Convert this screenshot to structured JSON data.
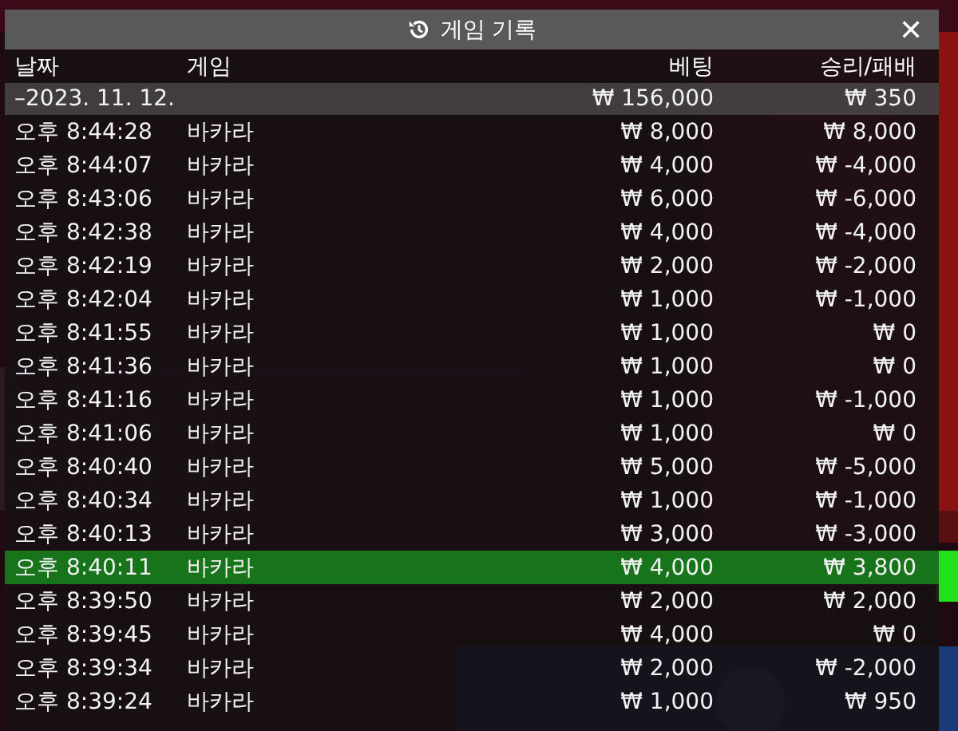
{
  "dialog": {
    "title": "게임 기록",
    "close": "✕"
  },
  "table": {
    "columns": [
      "날짜",
      "게임",
      "베팅",
      "승리/패배"
    ],
    "summary": {
      "date": "–2023. 11. 12.",
      "bet": "₩ 156,000",
      "result": "₩ 350"
    },
    "rows": [
      {
        "time": "오후 8:44:28",
        "game": "바카라",
        "bet": "₩ 8,000",
        "result": "₩ 8,000",
        "selected": false
      },
      {
        "time": "오후 8:44:07",
        "game": "바카라",
        "bet": "₩ 4,000",
        "result": "₩ -4,000",
        "selected": false
      },
      {
        "time": "오후 8:43:06",
        "game": "바카라",
        "bet": "₩ 6,000",
        "result": "₩ -6,000",
        "selected": false
      },
      {
        "time": "오후 8:42:38",
        "game": "바카라",
        "bet": "₩ 4,000",
        "result": "₩ -4,000",
        "selected": false
      },
      {
        "time": "오후 8:42:19",
        "game": "바카라",
        "bet": "₩ 2,000",
        "result": "₩ -2,000",
        "selected": false
      },
      {
        "time": "오후 8:42:04",
        "game": "바카라",
        "bet": "₩ 1,000",
        "result": "₩ -1,000",
        "selected": false
      },
      {
        "time": "오후 8:41:55",
        "game": "바카라",
        "bet": "₩ 1,000",
        "result": "₩ 0",
        "selected": false
      },
      {
        "time": "오후 8:41:36",
        "game": "바카라",
        "bet": "₩ 1,000",
        "result": "₩ 0",
        "selected": false
      },
      {
        "time": "오후 8:41:16",
        "game": "바카라",
        "bet": "₩ 1,000",
        "result": "₩ -1,000",
        "selected": false
      },
      {
        "time": "오후 8:41:06",
        "game": "바카라",
        "bet": "₩ 1,000",
        "result": "₩ 0",
        "selected": false
      },
      {
        "time": "오후 8:40:40",
        "game": "바카라",
        "bet": "₩ 5,000",
        "result": "₩ -5,000",
        "selected": false
      },
      {
        "time": "오후 8:40:34",
        "game": "바카라",
        "bet": "₩ 1,000",
        "result": "₩ -1,000",
        "selected": false
      },
      {
        "time": "오후 8:40:13",
        "game": "바카라",
        "bet": "₩ 3,000",
        "result": "₩ -3,000",
        "selected": false
      },
      {
        "time": "오후 8:40:11",
        "game": "바카라",
        "bet": "₩ 4,000",
        "result": "₩ 3,800",
        "selected": true
      },
      {
        "time": "오후 8:39:50",
        "game": "바카라",
        "bet": "₩ 2,000",
        "result": "₩ 2,000",
        "selected": false
      },
      {
        "time": "오후 8:39:45",
        "game": "바카라",
        "bet": "₩ 4,000",
        "result": "₩ 0",
        "selected": false
      },
      {
        "time": "오후 8:39:34",
        "game": "바카라",
        "bet": "₩ 2,000",
        "result": "₩ -2,000",
        "selected": false
      },
      {
        "time": "오후 8:39:24",
        "game": "바카라",
        "bet": "₩ 1,000",
        "result": "₩ 950",
        "selected": false
      }
    ]
  }
}
